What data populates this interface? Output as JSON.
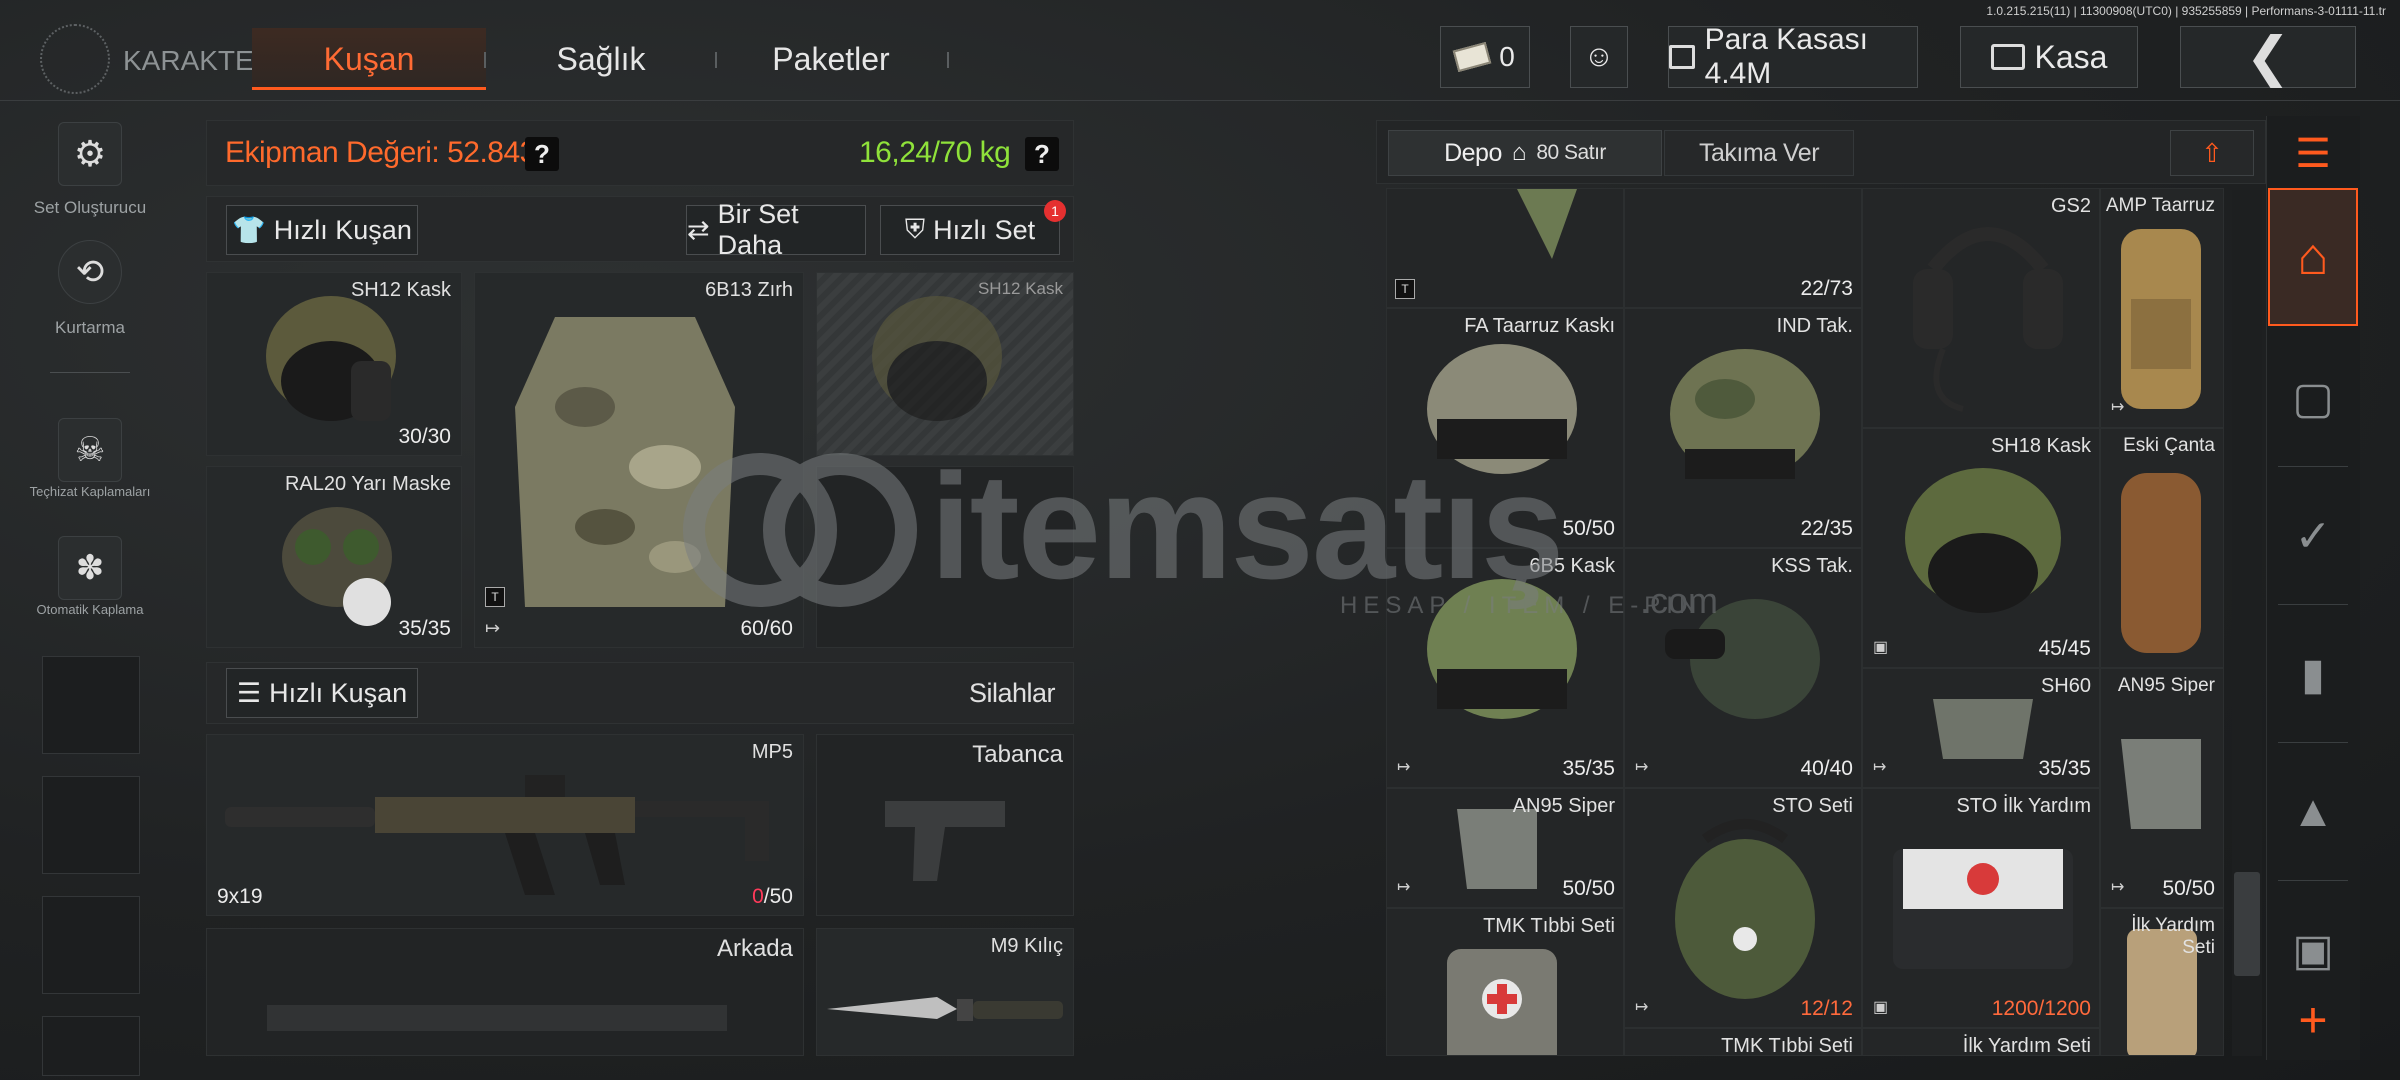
{
  "version": "1.0.215.215(11) | 11300908(UTC0) | 935255859 | Performans-3-01111-11.tr",
  "header": {
    "logo_text": "KARAKTER",
    "tabs": [
      "Kuşan",
      "Sağlık",
      "Paketler"
    ],
    "currency_value": "0",
    "vault_label": "Para Kasası 4.4M",
    "kasa_label": "Kasa"
  },
  "sidebar": {
    "items": [
      {
        "label": "Set Oluşturucu",
        "icon": "set-builder-icon"
      },
      {
        "label": "Kurtarma",
        "icon": "rescue-icon"
      },
      {
        "label": "Teçhizat Kaplamaları",
        "icon": "gear-skin-icon"
      },
      {
        "label": "Otomatik Kaplama",
        "icon": "auto-skin-icon"
      }
    ]
  },
  "equipment": {
    "value_label": "Ekipman Değeri: 52.843",
    "weight_label": "16,24/70 kg",
    "quick_equip_label": "Hızlı Kuşan",
    "another_set_label": "Bir Set Daha",
    "quick_set_label": "Hızlı Set",
    "quick_set_badge": "1",
    "slots": {
      "helmet": {
        "name": "SH12 Kask",
        "durability": "30/30"
      },
      "armor": {
        "name": "6B13 Zırh",
        "durability": "60/60",
        "tag": "T"
      },
      "helmet_ghost": {
        "name": "SH12 Kask"
      },
      "mask": {
        "name": "RAL20 Yarı Maske",
        "durability": "35/35"
      }
    }
  },
  "weapons": {
    "quick_equip_label": "Hızlı Kuşan",
    "title": "Silahlar",
    "primary": {
      "name": "MP5",
      "caliber": "9x19",
      "ammo_current": "0",
      "ammo_max": "/50"
    },
    "pistol": {
      "name": "Tabanca"
    },
    "back": {
      "name": "Arkada"
    },
    "melee": {
      "name": "M9 Kılıç"
    }
  },
  "storage": {
    "tab_depo": "Depo",
    "rows_label": "80 Satır",
    "tab_team": "Takıma Ver",
    "items": [
      {
        "name": "",
        "dur": "",
        "tag": "T"
      },
      {
        "name": "",
        "dur": "22/73"
      },
      {
        "name": "GS2",
        "dur": ""
      },
      {
        "name": "AMP Taarruz",
        "dur": ""
      },
      {
        "name": "FA Taarruz Kaskı",
        "dur": "50/50"
      },
      {
        "name": "IND Tak.",
        "dur": "22/35"
      },
      {
        "name": "SH18 Kask",
        "dur": "45/45"
      },
      {
        "name": "Eski Çanta",
        "dur": ""
      },
      {
        "name": "6B5 Kask",
        "dur": "35/35"
      },
      {
        "name": "KSS Tak.",
        "dur": "40/40"
      },
      {
        "name": "SH60",
        "dur": "35/35"
      },
      {
        "name": "AN95 Siper",
        "dur": "50/50"
      },
      {
        "name": "AN95 Siper",
        "dur": "50/50"
      },
      {
        "name": "STO Seti",
        "dur": "12/12"
      },
      {
        "name": "STO İlk Yardım",
        "dur": "1200/1200"
      },
      {
        "name": "İlk Yardım Seti",
        "dur": ""
      },
      {
        "name": "TMK Tıbbi Seti",
        "dur": ""
      },
      {
        "name": "TMK Tıbbi Seti",
        "dur": ""
      },
      {
        "name": "İlk Yardım Seti",
        "dur": ""
      }
    ]
  },
  "watermark": {
    "brand": "itemsatış",
    "tagline": "HESAP / ITEM / E-PIN",
    "dotcom": ".com"
  },
  "colors": {
    "accent": "#ff5a1e",
    "weight_green": "#8fe23a",
    "value_orange": "#ff6a2c"
  }
}
